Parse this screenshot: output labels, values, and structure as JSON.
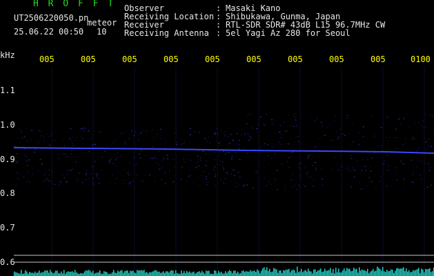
{
  "header": {
    "title": "H R O F F T",
    "file_name": "UT2506220050.pn",
    "tag": "meteor",
    "date_time": "25.06.22 00:50",
    "count": "10"
  },
  "info": [
    {
      "key": "Observer",
      "value": "Masaki Kano"
    },
    {
      "key": "Receiving Location",
      "value": "Shibukawa, Gunma, Japan"
    },
    {
      "key": "Receiver",
      "value": "RTL-SDR SDR# 43dB L15 96.7MHz CW"
    },
    {
      "key": "Receiving Antenna",
      "value": "5el Yagi Az 280 for Seoul"
    }
  ],
  "axis": {
    "y_unit": "kHz",
    "y_ticks": [
      "1.1",
      "1.0",
      "0.9",
      "0.8",
      "0.7",
      "0.6"
    ],
    "x_ticks": [
      "005",
      "005",
      "005",
      "005",
      "005",
      "005",
      "005",
      "005",
      "005",
      "0100"
    ]
  },
  "colors": {
    "signal": "#3b49ff",
    "header_green": "#22dd22",
    "header_white": "#e8e8e8",
    "tick_yellow": "#ffff00",
    "noise": "#22d3c8",
    "hline": "#c8c8c8"
  }
}
